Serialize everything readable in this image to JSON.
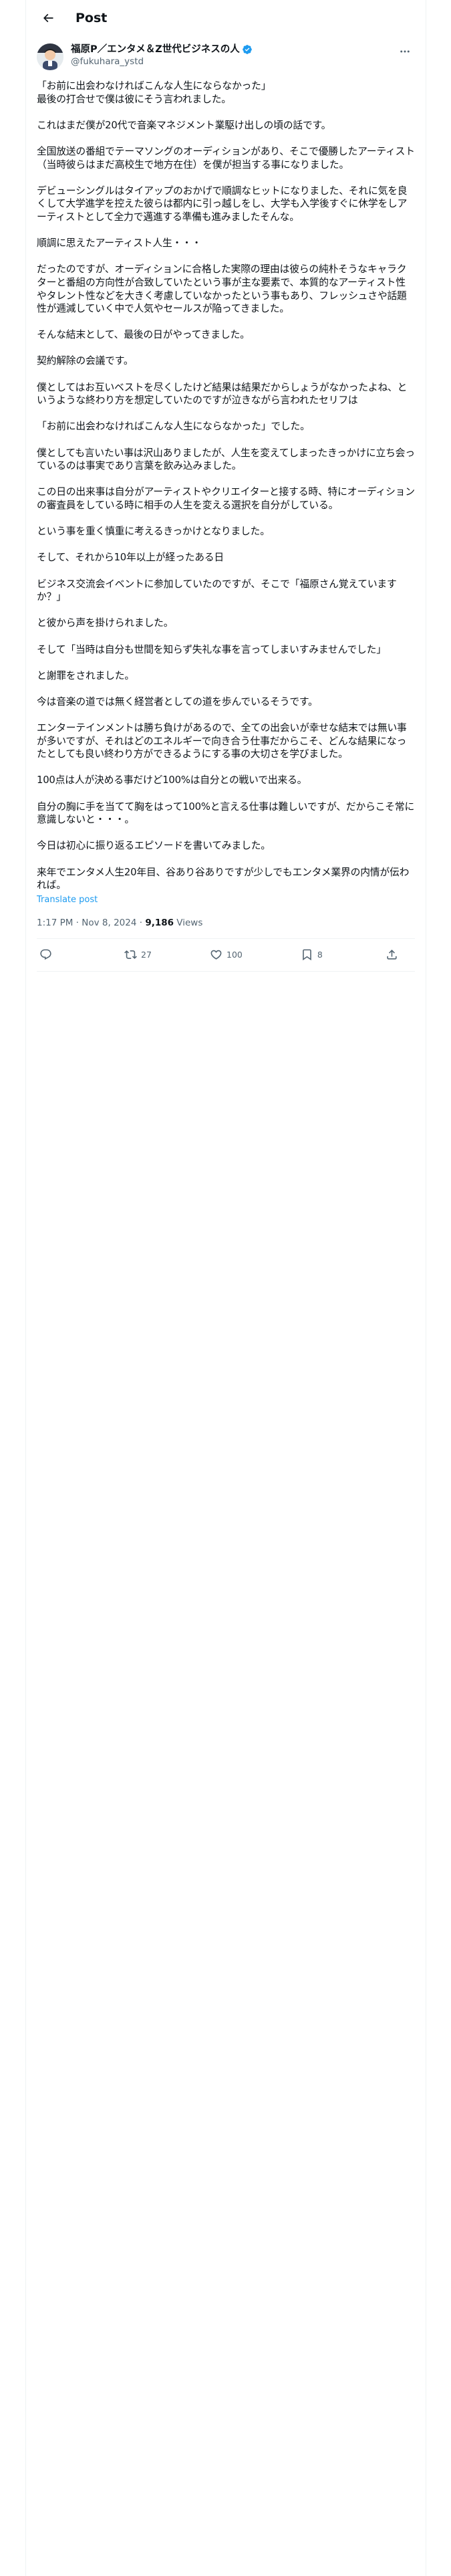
{
  "header": {
    "title": "Post"
  },
  "author": {
    "name": "福原P／エンタメ＆Z世代ビジネスの人",
    "handle": "@fukuhara_ystd"
  },
  "tweet": {
    "paragraphs": [
      "「お前に出会わなければこんな人生にならなかった」\n最後の打合せで僕は彼にそう言われました。",
      "これはまだ僕が20代で音楽マネジメント業駆け出しの頃の話です。",
      "全国放送の番組でテーマソングのオーディションがあり、そこで優勝したアーティスト（当時彼らはまだ高校生で地方在住）を僕が担当する事になりました。",
      "デビューシングルはタイアップのおかげで順調なヒットになりました、それに気を良くして大学進学を控えた彼らは都内に引っ越しをし、大学も入学後すぐに休学をしアーティストとして全力で邁進する準備も進みましたそんな。",
      "順調に思えたアーティスト人生・・・",
      "だったのですが、オーディションに合格した実際の理由は彼らの純朴そうなキャラクターと番組の方向性が合致していたという事が主な要素で、本質的なアーティスト性やタレント性などを大きく考慮していなかったという事もあり、フレッシュさや話題性が逓減していく中で人気やセールスが陥ってきました。",
      "そんな結末として、最後の日がやってきました。",
      "契約解除の会議です。",
      "僕としてはお互いベストを尽くしたけど結果は結果だからしょうがなかったよね、というような終わり方を想定していたのですが泣きながら言われたセリフは",
      "「お前に出会わなければこんな人生にならなかった」でした。",
      "僕としても言いたい事は沢山ありましたが、人生を変えてしまったきっかけに立ち会っているのは事実であり言葉を飲み込みました。",
      "この日の出来事は自分がアーティストやクリエイターと接する時、特にオーディションの審査員をしている時に相手の人生を変える選択を自分がしている。",
      "という事を重く慎重に考えるきっかけとなりました。",
      "そして、それから10年以上が経ったある日",
      "ビジネス交流会イベントに参加していたのですが、そこで「福原さん覚えていますか？」",
      "と彼から声を掛けられました。",
      "そして「当時は自分も世間を知らず失礼な事を言ってしまいすみませんでした」",
      "と謝罪をされました。",
      "今は音楽の道では無く経営者としての道を歩んでいるそうです。",
      "エンターテインメントは勝ち負けがあるので、全ての出会いが幸せな結末では無い事が多いですが、それはどのエネルギーで向き合う仕事だからこそ、どんな結果になったとしても良い終わり方ができるようにする事の大切さを学びました。",
      "100点は人が決める事だけど100%は自分との戦いで出来る。",
      "自分の胸に手を当てて胸をはって100%と言える仕事は難しいですが、だからこそ常に意識しないと・・・。",
      "今日は初心に振り返るエピソードを書いてみました。",
      "来年でエンタメ人生20年目、谷あり谷ありですが少しでもエンタメ業界の内情が伝われば。"
    ],
    "translate_label": "Translate post",
    "time": "1:17 PM · Nov 8, 2024 · ",
    "views_count": "9,186",
    "views_label": " Views"
  },
  "actions": {
    "reply_count": "",
    "repost_count": "27",
    "like_count": "100",
    "bookmark_count": "8"
  },
  "icons": {
    "back": "back-arrow-icon",
    "more": "more-horizontal-icon",
    "verified": "verified-badge-icon",
    "reply": "reply-icon",
    "repost": "repost-icon",
    "like": "heart-icon",
    "bookmark": "bookmark-icon",
    "share": "share-icon"
  },
  "colors": {
    "accent": "#1d9bf0",
    "secondary_text": "#536471",
    "border": "#eff3f4"
  }
}
